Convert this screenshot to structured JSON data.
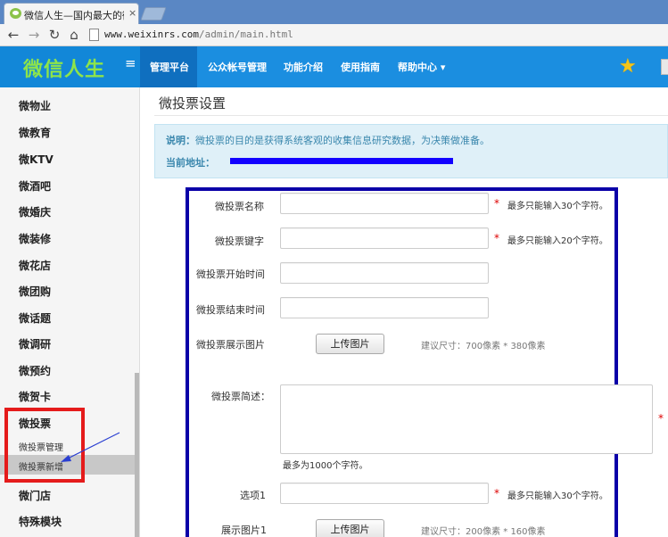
{
  "browser": {
    "tab_title": "微信人生—国内最大的微信",
    "tab_close": "×",
    "url_host": "www.weixinrs.com",
    "url_path": "/admin/main.html",
    "back": "←",
    "forward": "→",
    "reload": "↻",
    "home": "⌂"
  },
  "header": {
    "logo": "微信人生",
    "menu_toggle": "≡",
    "nav": [
      "管理平台",
      "公众帐号管理",
      "功能介绍",
      "使用指南",
      "帮助中心 ▾"
    ],
    "star": "★"
  },
  "sidebar": {
    "items": [
      "微物业",
      "微教育",
      "微KTV",
      "微酒吧",
      "微婚庆",
      "微装修",
      "微花店",
      "微团购",
      "微话题",
      "微调研",
      "微预约",
      "微贺卡",
      "微投票",
      "微门店",
      "特殊模块"
    ],
    "sub_items": [
      "微投票管理",
      "微投票新增"
    ]
  },
  "page": {
    "title": "微投票设置",
    "info_label": "说明：",
    "info_text": "微投票的目的是获得系统客观的收集信息研究数据，为决策做准备。",
    "address_label": "当前地址："
  },
  "form": {
    "name_label": "微投票名称",
    "name_value": "",
    "name_hint": "最多只能输入30个字符。",
    "keyword_label": "微投票键字",
    "keyword_value": "",
    "keyword_hint": "最多只能输入20个字符。",
    "start_label": "微投票开始时间",
    "start_value": "",
    "end_label": "微投票结束时间",
    "end_value": "",
    "image_label": "微投票展示图片",
    "upload_label": "上传图片",
    "image_size_hint": "建议尺寸：700像素 * 380像素",
    "desc_label": "微投票简述：",
    "desc_value": "",
    "desc_hint": "最多为1000个字符。",
    "option1_label": "选项1",
    "option1_value": "",
    "option1_hint": "最多只能输入30个字符。",
    "option1_image_label": "展示图片1",
    "option1_image_hint": "建议尺寸：200像素 * 160像素",
    "required_mark": "*"
  }
}
